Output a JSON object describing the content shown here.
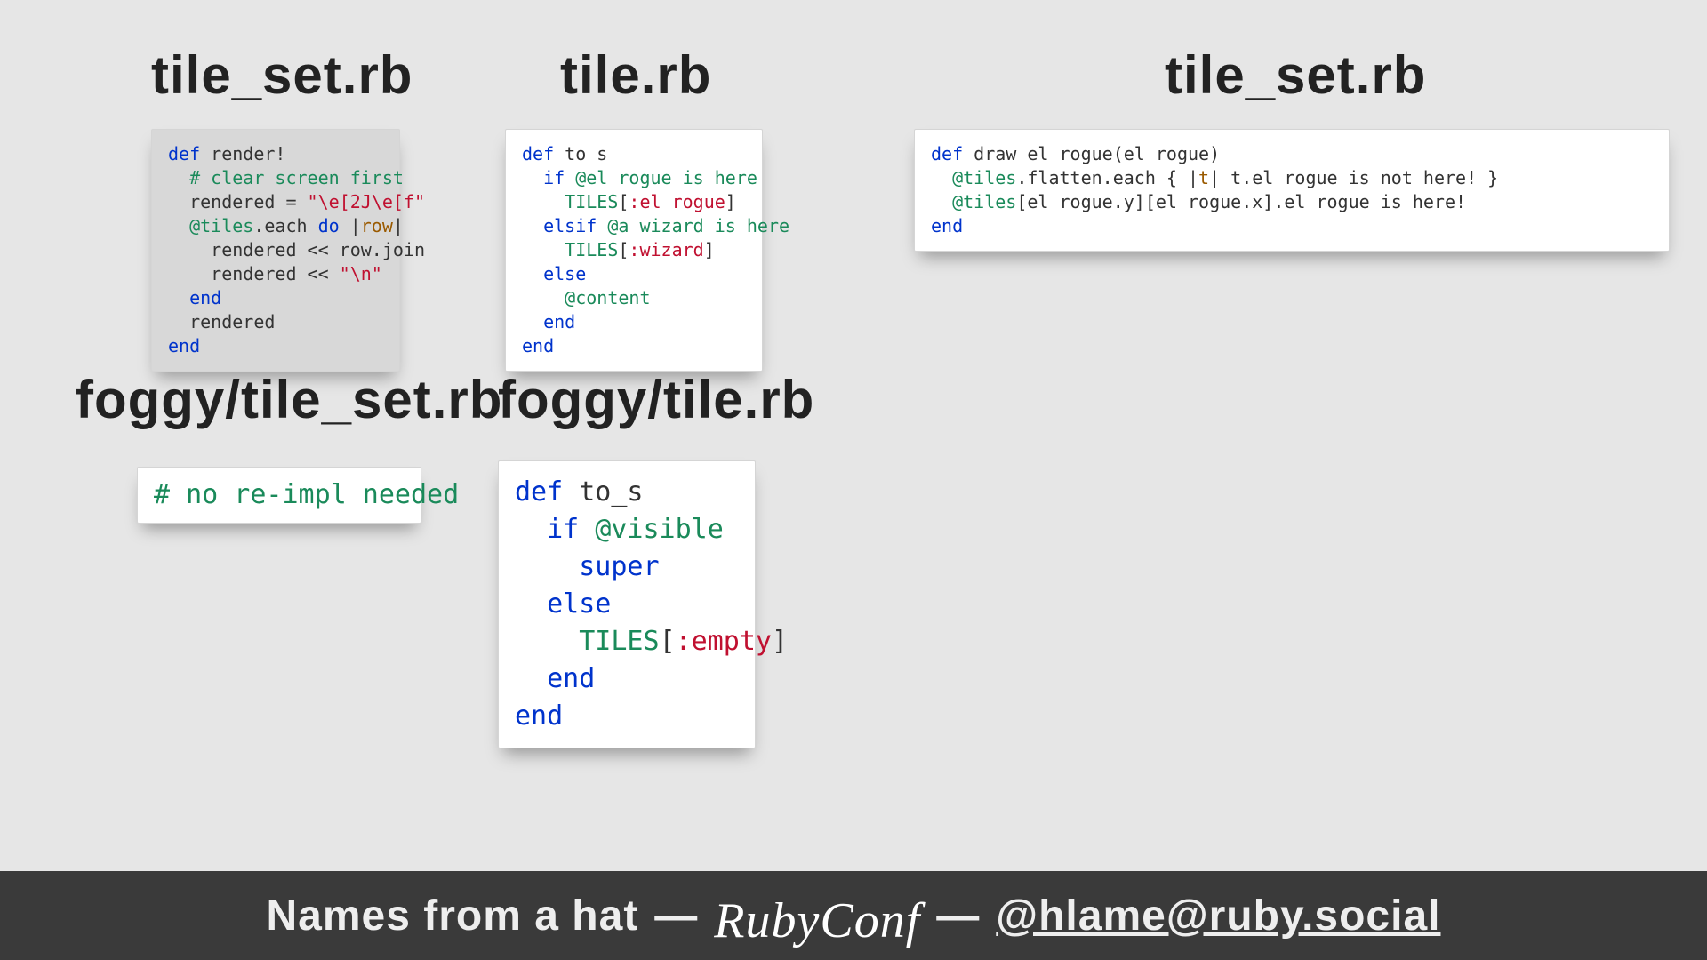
{
  "headings": {
    "h1": "tile_set.rb",
    "h2": "tile.rb",
    "h3": "tile_set.rb",
    "h4": "foggy/tile_set.rb",
    "h5": "foggy/tile.rb"
  },
  "code": {
    "c1": {
      "tokens": [
        {
          "t": "def ",
          "c": "kw"
        },
        {
          "t": "render!\n"
        },
        {
          "t": "  # clear screen first\n",
          "c": "comment"
        },
        {
          "t": "  rendered = "
        },
        {
          "t": "\"\\e[2J\\e[f\"",
          "c": "str"
        },
        {
          "t": "\n"
        },
        {
          "t": "  @tiles",
          "c": "ivar"
        },
        {
          "t": ".each "
        },
        {
          "t": "do ",
          "c": "kw"
        },
        {
          "t": "|"
        },
        {
          "t": "row",
          "c": "arg"
        },
        {
          "t": "|\n"
        },
        {
          "t": "    rendered << row.join\n"
        },
        {
          "t": "    rendered << "
        },
        {
          "t": "\"\\n\"",
          "c": "str"
        },
        {
          "t": "\n"
        },
        {
          "t": "  end\n",
          "c": "kw"
        },
        {
          "t": "  rendered\n"
        },
        {
          "t": "end",
          "c": "kw"
        }
      ]
    },
    "c2": {
      "tokens": [
        {
          "t": "def ",
          "c": "kw"
        },
        {
          "t": "to_s\n"
        },
        {
          "t": "  if ",
          "c": "kw"
        },
        {
          "t": "@el_rogue_is_here",
          "c": "ivar"
        },
        {
          "t": "\n"
        },
        {
          "t": "    TILES",
          "c": "const"
        },
        {
          "t": "["
        },
        {
          "t": ":el_rogue",
          "c": "sym"
        },
        {
          "t": "]\n"
        },
        {
          "t": "  elsif ",
          "c": "kw"
        },
        {
          "t": "@a_wizard_is_here",
          "c": "ivar"
        },
        {
          "t": "\n"
        },
        {
          "t": "    TILES",
          "c": "const"
        },
        {
          "t": "["
        },
        {
          "t": ":wizard",
          "c": "sym"
        },
        {
          "t": "]\n"
        },
        {
          "t": "  else\n",
          "c": "kw"
        },
        {
          "t": "    @content",
          "c": "ivar"
        },
        {
          "t": "\n"
        },
        {
          "t": "  end\n",
          "c": "kw"
        },
        {
          "t": "end",
          "c": "kw"
        }
      ]
    },
    "c3": {
      "tokens": [
        {
          "t": "def ",
          "c": "kw"
        },
        {
          "t": "draw_el_rogue(el_rogue)\n"
        },
        {
          "t": "  @tiles",
          "c": "ivar"
        },
        {
          "t": ".flatten.each { |"
        },
        {
          "t": "t",
          "c": "arg"
        },
        {
          "t": "| t.el_rogue_is_not_here! }\n"
        },
        {
          "t": "  @tiles",
          "c": "ivar"
        },
        {
          "t": "[el_rogue.y][el_rogue.x].el_rogue_is_here!\n"
        },
        {
          "t": "end",
          "c": "kw"
        }
      ]
    },
    "c4": {
      "tokens": [
        {
          "t": "# no re-impl needed",
          "c": "comment"
        }
      ]
    },
    "c5": {
      "tokens": [
        {
          "t": "def ",
          "c": "kw"
        },
        {
          "t": "to_s\n"
        },
        {
          "t": "  if ",
          "c": "kw"
        },
        {
          "t": "@visible",
          "c": "ivar"
        },
        {
          "t": "\n"
        },
        {
          "t": "    super\n",
          "c": "kw"
        },
        {
          "t": "  else\n",
          "c": "kw"
        },
        {
          "t": "    TILES",
          "c": "const"
        },
        {
          "t": "["
        },
        {
          "t": ":empty",
          "c": "sym"
        },
        {
          "t": "]\n"
        },
        {
          "t": "  end\n",
          "c": "kw"
        },
        {
          "t": "end",
          "c": "kw"
        }
      ]
    }
  },
  "footer": {
    "title": "Names from a hat",
    "conf": "RubyConf",
    "handle": "@hlame@ruby.social"
  }
}
